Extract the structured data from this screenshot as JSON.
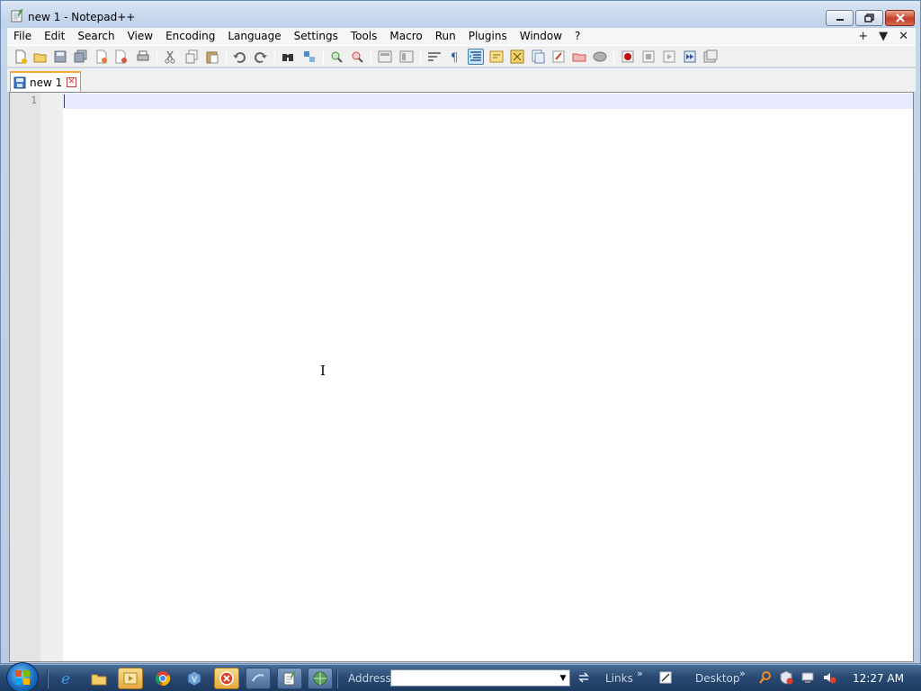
{
  "window": {
    "title": "new 1 - Notepad++"
  },
  "menu": {
    "items": [
      "File",
      "Edit",
      "Search",
      "View",
      "Encoding",
      "Language",
      "Settings",
      "Tools",
      "Macro",
      "Run",
      "Plugins",
      "Window",
      "?"
    ],
    "right_controls": [
      "+",
      "▼",
      "✕"
    ]
  },
  "toolbar": {
    "buttons": [
      "new-file-icon",
      "open-file-icon",
      "save-icon",
      "save-all-icon",
      "close-icon",
      "close-all-icon",
      "print-icon",
      "cut-icon",
      "copy-icon",
      "paste-icon",
      "undo-icon",
      "redo-icon",
      "find-icon",
      "replace-icon",
      "zoom-in-icon",
      "zoom-out-icon",
      "sync-vertical-icon",
      "sync-horizontal-icon",
      "word-wrap-icon",
      "show-all-characters-icon",
      "indent-guide-icon",
      "user-defined-language-icon",
      "document-map-icon",
      "function-list-icon",
      "folder-as-workspace-icon",
      "monitoring-icon",
      "doc-switcher-icon",
      "record-macro-icon",
      "stop-recording-icon",
      "play-macro-icon",
      "run-macro-multiple-icon",
      "save-macro-icon"
    ],
    "active_button": "indent-guide-icon"
  },
  "tabs": [
    {
      "label": "new 1",
      "saved": true
    }
  ],
  "editor": {
    "lines": [
      ""
    ],
    "line_numbers": [
      "1"
    ],
    "current_line": 1
  },
  "taskbar": {
    "address_label": "Address",
    "address_value": "",
    "links_label": "Links",
    "desktop_label": "Desktop",
    "clock": "12:27 AM",
    "pinned": [
      "internet-explorer-icon",
      "windows-explorer-icon",
      "media-player-icon",
      "chrome-icon",
      "virtualbox-icon",
      "stop-app-icon",
      "network-app-icon",
      "notepadpp-icon",
      "globe-app-icon"
    ]
  }
}
